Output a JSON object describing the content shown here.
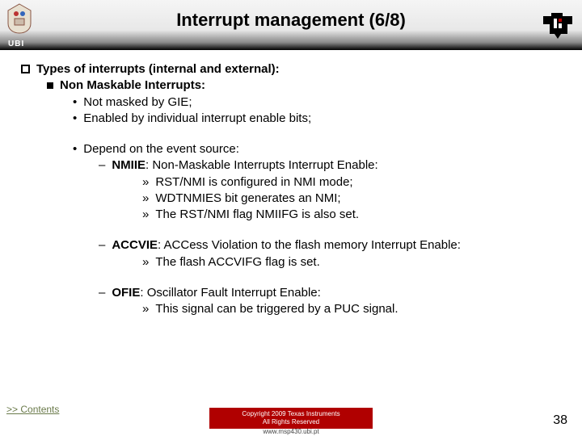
{
  "header": {
    "title": "Interrupt management (6/8)",
    "ubi": "UBI"
  },
  "content": {
    "l1": "Types of interrupts (internal and external):",
    "l2": "Non Maskable Interrupts:",
    "l3a": "Not masked by GIE;",
    "l3b": "Enabled by individual interrupt enable bits;",
    "l3c": "Depend on the event source:",
    "nmiie_label": "NMIIE",
    "nmiie_rest": ": Non-Maskable Interrupts Interrupt Enable:",
    "nmiie_a": "RST/NMI is configured in NMI mode;",
    "nmiie_b": "WDTNMIES bit generates an NMI;",
    "nmiie_c": "The RST/NMI flag NMIIFG is also set.",
    "accvie_label": "ACCVIE",
    "accvie_rest": ": ACCess Violation to the flash memory Interrupt Enable:",
    "accvie_a": "The flash ACCVIFG flag is set.",
    "ofie_label": "OFIE",
    "ofie_rest": ": Oscillator Fault Interrupt Enable:",
    "ofie_a": "This signal can be triggered by a PUC signal."
  },
  "footer": {
    "contents": ">> Contents",
    "copyright1": "Copyright  2009 Texas Instruments",
    "copyright2": "All Rights Reserved",
    "url": "www.msp430.ubi.pt",
    "page": "38"
  }
}
